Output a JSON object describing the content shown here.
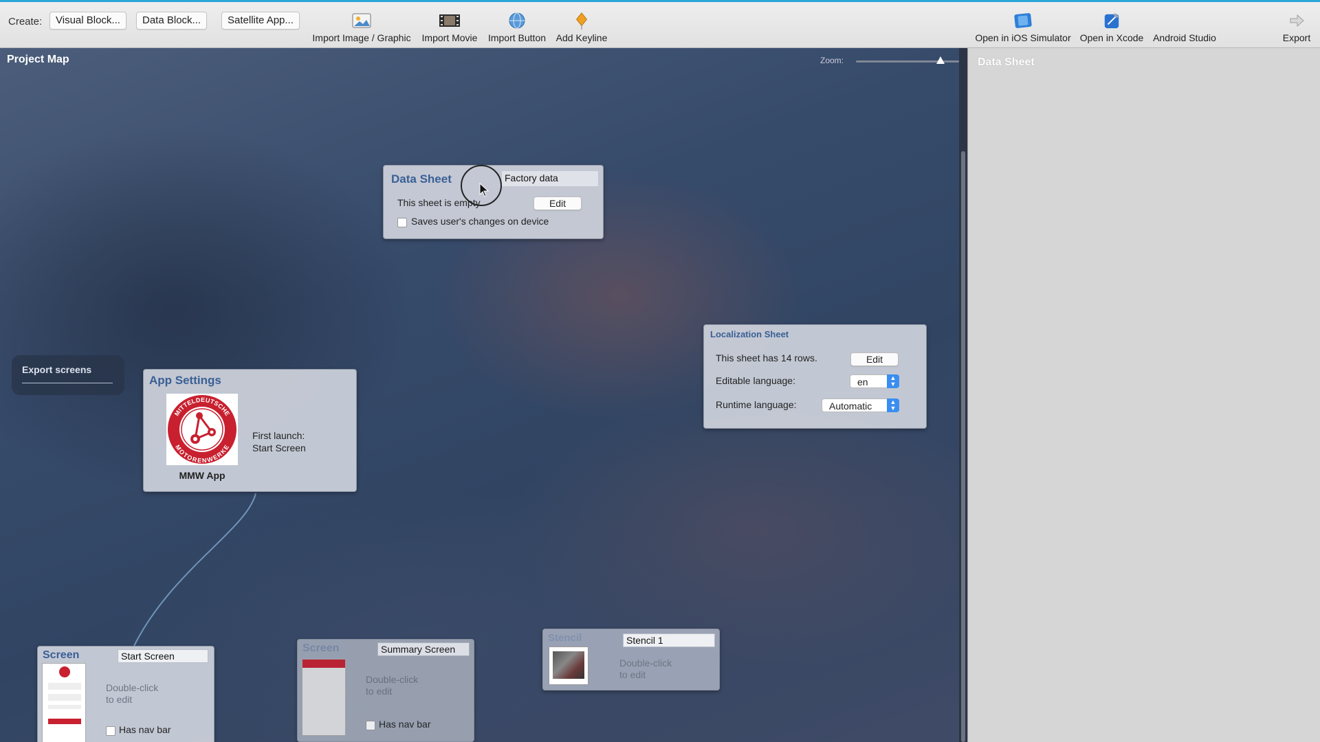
{
  "toolbar": {
    "create_label": "Create:",
    "create_buttons": [
      "Visual Block...",
      "Data Block...",
      "Satellite App..."
    ],
    "tools": [
      {
        "label": "Import Image / Graphic",
        "icon": "image-icon"
      },
      {
        "label": "Import Movie",
        "icon": "film-icon"
      },
      {
        "label": "Import Button",
        "icon": "button-globe-icon"
      },
      {
        "label": "Add Keyline",
        "icon": "keyline-pin-icon"
      }
    ],
    "right_tools": [
      {
        "label": "Open in iOS Simulator",
        "icon": "ios-simulator-icon"
      },
      {
        "label": "Open in Xcode",
        "icon": "xcode-icon"
      },
      {
        "label": "Android Studio",
        "icon": ""
      },
      {
        "label": "Export",
        "icon": "export-arrow-icon"
      }
    ]
  },
  "map": {
    "title": "Project Map",
    "zoom_label": "Zoom:",
    "zoom_level": 0.82,
    "export_screens": "Export screens",
    "data_sheet": {
      "title": "Data Sheet",
      "name": "Factory data",
      "status": "This sheet is empty.",
      "edit": "Edit",
      "saves_changes": "Saves user's changes on device",
      "saves_changes_checked": false
    },
    "localization_sheet": {
      "title": "Localization Sheet",
      "rows_text": "This sheet has 14 rows.",
      "edit": "Edit",
      "editable_language_label": "Editable language:",
      "editable_language_value": "en",
      "runtime_language_label": "Runtime language:",
      "runtime_language_value": "Automatic"
    },
    "app_settings": {
      "title": "App Settings",
      "logo_text_top": "MITTELDEUTSCHE",
      "logo_text_bottom": "MOTORENWERKE",
      "app_name": "MMW App",
      "first_launch_label": "First launch:",
      "first_launch_value": "Start Screen"
    },
    "screens": [
      {
        "title": "Screen",
        "name": "Start Screen",
        "hint1": "Double-click",
        "hint2": "to edit",
        "nav_bar": "Has nav bar"
      },
      {
        "title": "Screen",
        "name": "Summary Screen",
        "hint1": "Double-click",
        "hint2": "to edit",
        "nav_bar": "Has nav bar"
      }
    ],
    "stencil": {
      "title": "Stencil",
      "name": "Stencil 1",
      "hint1": "Double-click",
      "hint2": "to edit"
    }
  },
  "inspector": {
    "title": "Data Sheet"
  },
  "colors": {
    "accent": "#3a5f95",
    "brand_red": "#c8202f",
    "toolbar_bg": "#e6e6e6"
  }
}
